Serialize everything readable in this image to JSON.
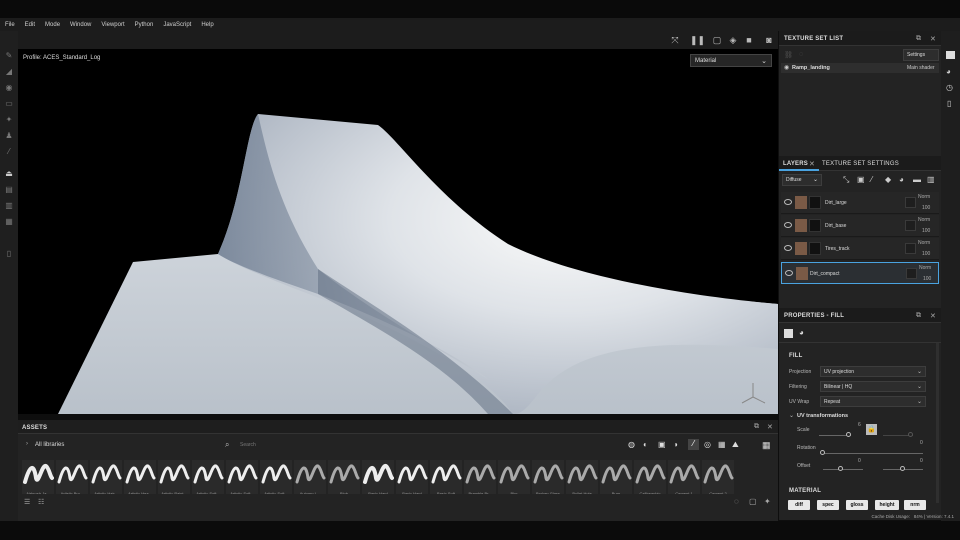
{
  "menu": [
    "File",
    "Edit",
    "Mode",
    "Window",
    "Viewport",
    "Python",
    "JavaScript",
    "Help"
  ],
  "viewport": {
    "profile": "Profile: ACES_Standard_Log",
    "material_select": "Material"
  },
  "texture_set_list": {
    "title": "TEXTURE SET LIST",
    "settings_label": "Settings",
    "item_name": "Ramp_landing",
    "item_shader": "Main shader"
  },
  "layers": {
    "tab_layers": "LAYERS",
    "tab_settings": "TEXTURE SET SETTINGS",
    "channel": "Diffuse",
    "items": [
      {
        "name": "Dirt_large",
        "blend": "Norm",
        "opacity": "100"
      },
      {
        "name": "Dirt_base",
        "blend": "Norm",
        "opacity": "100"
      },
      {
        "name": "Tires_track",
        "blend": "Norm",
        "opacity": "100"
      },
      {
        "name": "Dirt_compact",
        "blend": "Norm",
        "opacity": "100"
      }
    ]
  },
  "properties": {
    "title": "PROPERTIES - FILL",
    "section_fill": "FILL",
    "projection_label": "Projection",
    "projection_value": "UV projection",
    "filtering_label": "Filtering",
    "filtering_value": "Bilinear | HQ",
    "uvwrap_label": "UV Wrap",
    "uvwrap_value": "Repeat",
    "uv_transformations": "UV transformations",
    "scale_label": "Scale",
    "scale_value": "6",
    "rotation_label": "Rotation",
    "rotation_value": "0",
    "offset_label": "Offset",
    "offset_x": "0",
    "offset_y": "0",
    "section_material": "MATERIAL",
    "channels": [
      "diff",
      "spec",
      "gloss",
      "height",
      "nrm"
    ]
  },
  "assets": {
    "title": "ASSETS",
    "library": "All libraries",
    "search_placeholder": "Search",
    "items": [
      "Airbrush Ja...",
      "Artistic Bru...",
      "Artistic Hair...",
      "Artistic Hea...",
      "Artistic Paint...",
      "Artistic Soft...",
      "Artistic Soft...",
      "Artistic Soft...",
      "Autumn L...",
      "Blob",
      "Basic Hard",
      "Basic Hard",
      "Basic Soft",
      "Bramble Br...",
      "Blur",
      "Broken Glass",
      "Bullet Hole",
      "Burn",
      "Calligraphic",
      "Cement 1",
      "Cement 2"
    ]
  },
  "status": {
    "cache": "Cache Disk Usage:   84% | Version: 7.4.1"
  }
}
